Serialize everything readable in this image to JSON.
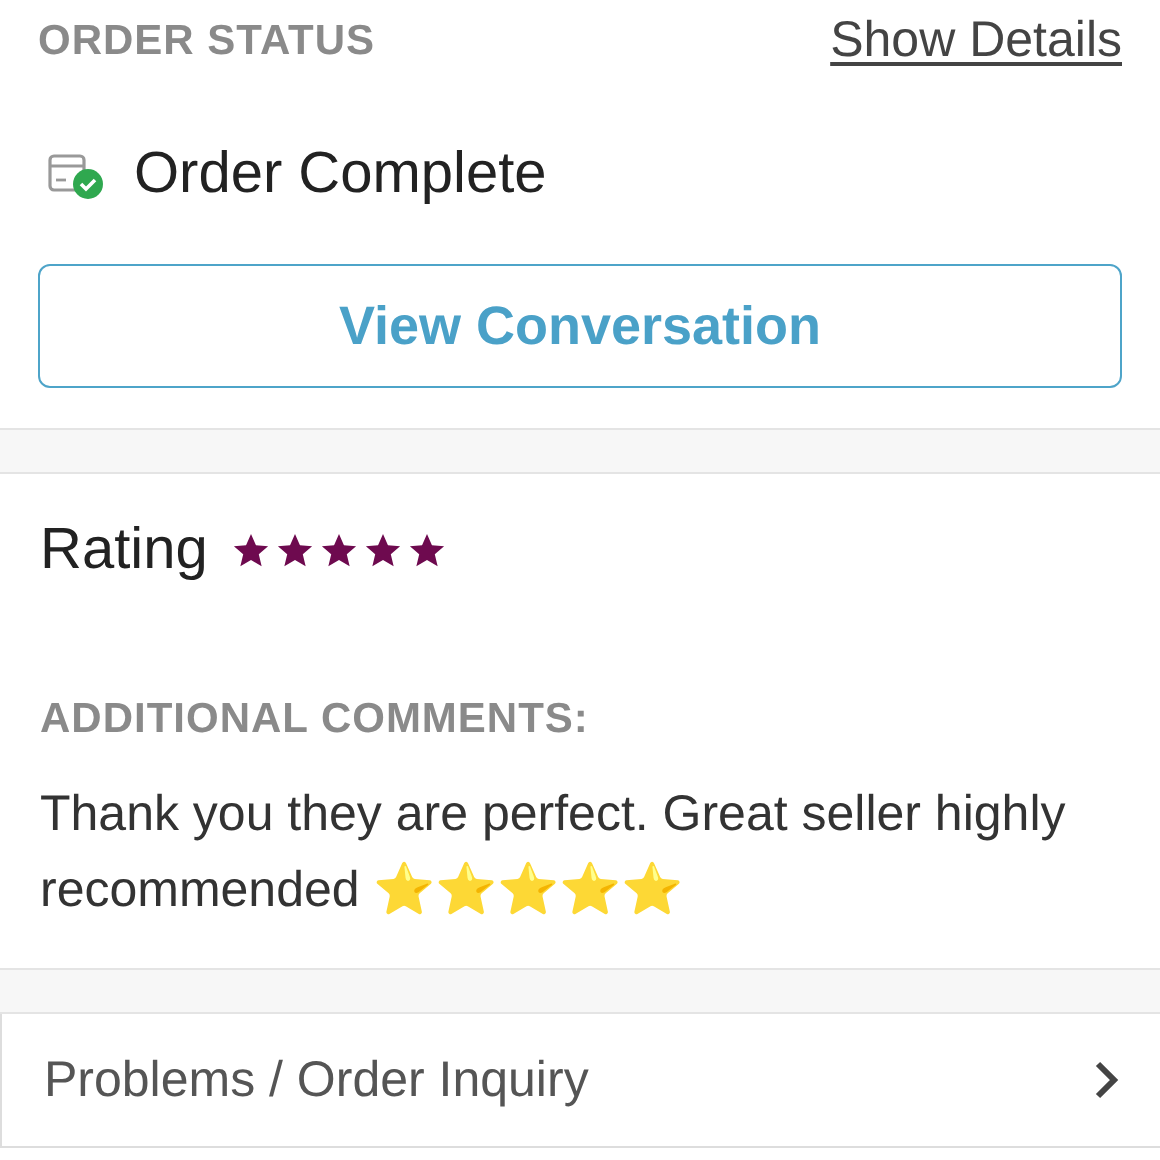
{
  "order_status": {
    "heading": "ORDER STATUS",
    "details_link": "Show Details",
    "status": "Order Complete",
    "button": "View Conversation"
  },
  "rating": {
    "label": "Rating",
    "stars": 5
  },
  "comments": {
    "heading": "ADDITIONAL COMMENTS:",
    "text": "Thank you they are perfect. Great seller highly recommended ⭐⭐⭐⭐⭐"
  },
  "menu_items": [
    {
      "label": "Problems / Order Inquiry"
    }
  ]
}
